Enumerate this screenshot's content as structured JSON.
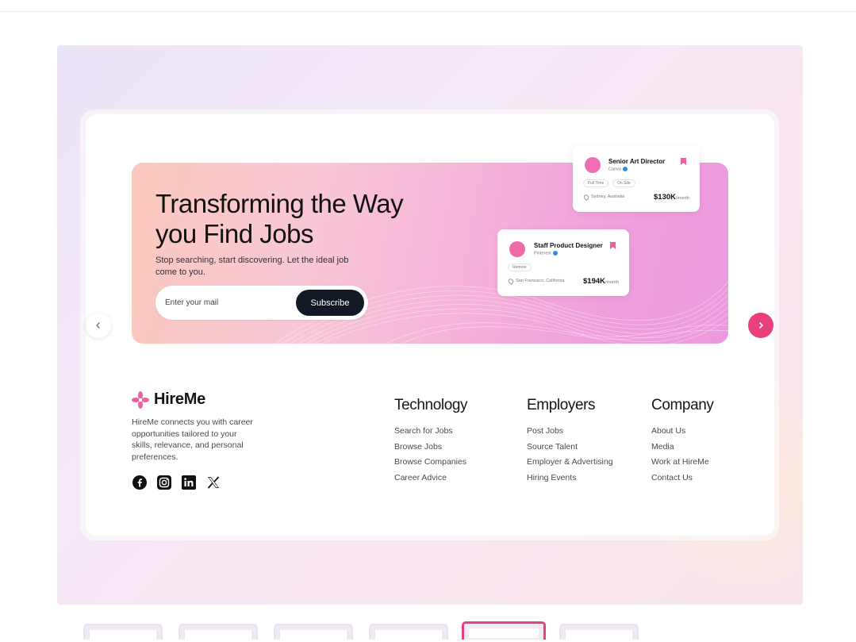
{
  "hero": {
    "headline": "Transforming the Way you Find Jobs",
    "subtext": "Stop searching, start discovering. Let the ideal job come to you.",
    "email_placeholder": "Enter your mail",
    "subscribe_label": "Subscribe"
  },
  "job_cards": [
    {
      "title": "Senior Art Director",
      "company": "Canva",
      "tags": [
        "Full Time",
        "On Site"
      ],
      "location": "Sydney, Australia",
      "salary": "$130K",
      "salary_unit": "/month",
      "logo_color": "#f06fb4"
    },
    {
      "title": "Staff Product Designer",
      "company": "Pinterest",
      "tags": [
        "Remote"
      ],
      "location": "San Francisco, California",
      "salary": "$194K",
      "salary_unit": "/month",
      "logo_color": "#ef6ba8"
    }
  ],
  "brand": {
    "name": "HireMe",
    "description": "HireMe connects you with career opportunities tailored to your skills, relevance, and personal preferences.",
    "socials": [
      "facebook-icon",
      "instagram-icon",
      "linkedin-icon",
      "x-icon"
    ]
  },
  "footer": {
    "columns": [
      {
        "heading": "Technology",
        "links": [
          "Search for Jobs",
          "Browse Jobs",
          "Browse Companies",
          "Career Advice"
        ]
      },
      {
        "heading": "Employers",
        "links": [
          "Post Jobs",
          "Source Talent",
          "Employer & Advertising",
          "Hiring Events"
        ]
      },
      {
        "heading": "Company",
        "links": [
          "About Us",
          "Media",
          "Work at HireMe",
          "Contact Us"
        ]
      }
    ]
  },
  "carousel": {
    "thumbnail_count": 6,
    "active_index": 4
  },
  "colors": {
    "accent": "#e83f7d",
    "button_dark": "#121826"
  }
}
